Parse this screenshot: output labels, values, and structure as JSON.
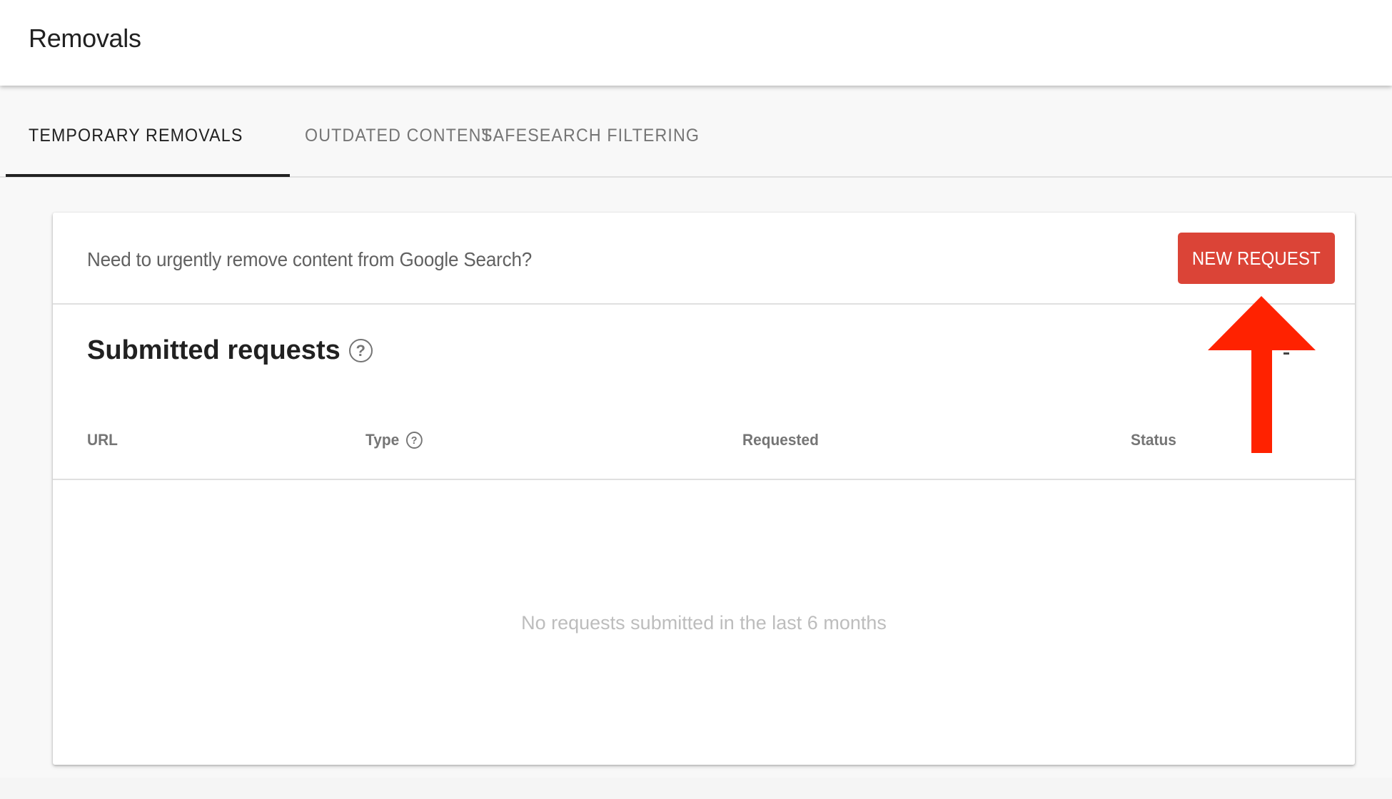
{
  "header": {
    "title": "Removals"
  },
  "tabs": [
    {
      "label": "TEMPORARY REMOVALS",
      "active": true
    },
    {
      "label": "OUTDATED CONTENT",
      "active": false
    },
    {
      "label": "SAFESEARCH FILTERING",
      "active": false
    }
  ],
  "card": {
    "prompt": "Need to urgently remove content from Google Search?",
    "new_request_label": "NEW REQUEST",
    "section_title": "Submitted requests",
    "help_icon_glyph": "?",
    "table": {
      "columns": [
        {
          "label": "URL",
          "has_help": false
        },
        {
          "label": "Type",
          "has_help": true
        },
        {
          "label": "Requested",
          "has_help": false
        },
        {
          "label": "Status",
          "has_help": false
        }
      ],
      "rows": [],
      "empty_message": "No requests submitted in the last 6 months"
    }
  },
  "annotation": {
    "type": "arrow-up",
    "points_to": "new-request-button",
    "color": "#ff2200"
  },
  "colors": {
    "accent_button": "#db4437",
    "primary_text": "#212121",
    "secondary_text": "#757575",
    "muted_text": "#bdbdbd"
  }
}
